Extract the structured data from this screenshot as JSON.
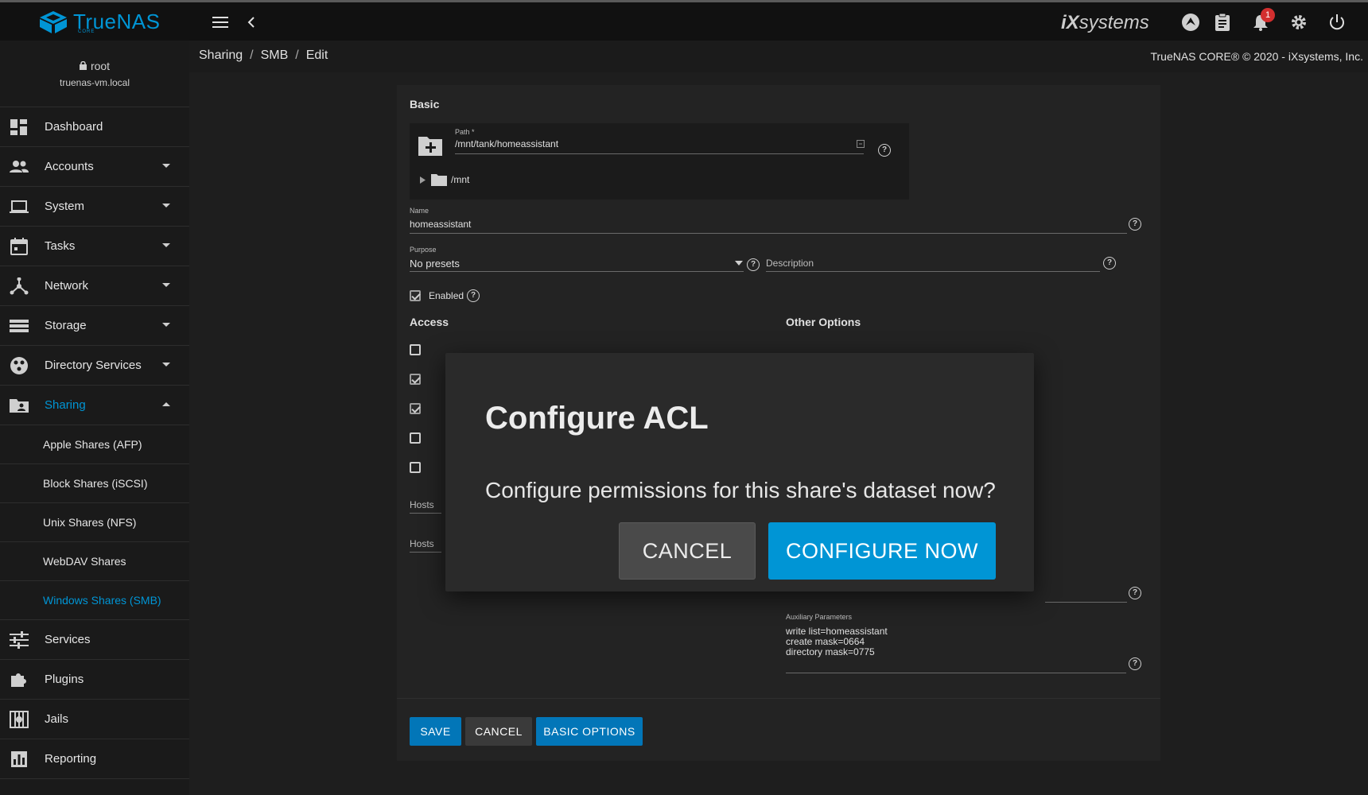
{
  "brand": {
    "name": "TrueNAS",
    "sub": "CORE"
  },
  "topbar": {
    "vendor_prefix": "iX",
    "vendor_suffix": "systems",
    "notification_count": "1"
  },
  "user": {
    "name": "root",
    "host": "truenas-vm.local"
  },
  "sidebar": {
    "items": [
      {
        "label": "Dashboard"
      },
      {
        "label": "Accounts"
      },
      {
        "label": "System"
      },
      {
        "label": "Tasks"
      },
      {
        "label": "Network"
      },
      {
        "label": "Storage"
      },
      {
        "label": "Directory Services"
      },
      {
        "label": "Sharing"
      }
    ],
    "sharing_sub": [
      {
        "label": "Apple Shares (AFP)"
      },
      {
        "label": "Block Shares (iSCSI)"
      },
      {
        "label": "Unix Shares (NFS)"
      },
      {
        "label": "WebDAV Shares"
      },
      {
        "label": "Windows Shares (SMB)"
      }
    ],
    "items_after": [
      {
        "label": "Services"
      },
      {
        "label": "Plugins"
      },
      {
        "label": "Jails"
      },
      {
        "label": "Reporting"
      }
    ]
  },
  "breadcrumb": {
    "c1": "Sharing",
    "c2": "SMB",
    "c3": "Edit",
    "sep": "/"
  },
  "copyright": "TrueNAS CORE® © 2020 - iXsystems, Inc.",
  "form": {
    "basic_title": "Basic",
    "path_label": "Path *",
    "path_value": "/mnt/tank/homeassistant",
    "tree_root": "/mnt",
    "name_label": "Name",
    "name_value": "homeassistant",
    "purpose_label": "Purpose",
    "purpose_value": "No presets",
    "description_placeholder": "Description",
    "enabled_label": "Enabled",
    "access_title": "Access",
    "other_title": "Other Options",
    "aux_label": "Auxiliary Parameters",
    "aux_lines": [
      "write list=homeassistant",
      "create mask=0664",
      "directory mask=0775"
    ],
    "hosts_allow_partial": "Hosts",
    "hosts_deny_partial": "Hosts",
    "save_label": "SAVE",
    "cancel_label": "CANCEL",
    "basic_options_label": "BASIC OPTIONS"
  },
  "dialog": {
    "title": "Configure ACL",
    "message": "Configure permissions for this share's dataset now?",
    "cancel_label": "CANCEL",
    "confirm_label": "CONFIGURE NOW"
  },
  "help_glyph": "?"
}
